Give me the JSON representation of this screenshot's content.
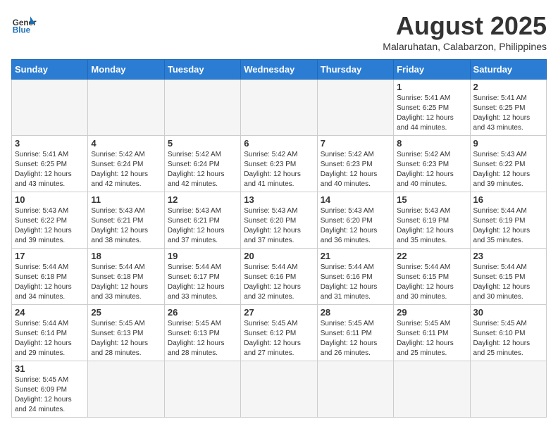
{
  "logo": {
    "text_general": "General",
    "text_blue": "Blue"
  },
  "title": "August 2025",
  "subtitle": "Malaruhatan, Calabarzon, Philippines",
  "weekdays": [
    "Sunday",
    "Monday",
    "Tuesday",
    "Wednesday",
    "Thursday",
    "Friday",
    "Saturday"
  ],
  "weeks": [
    [
      {
        "day": "",
        "info": ""
      },
      {
        "day": "",
        "info": ""
      },
      {
        "day": "",
        "info": ""
      },
      {
        "day": "",
        "info": ""
      },
      {
        "day": "",
        "info": ""
      },
      {
        "day": "1",
        "info": "Sunrise: 5:41 AM\nSunset: 6:25 PM\nDaylight: 12 hours\nand 44 minutes."
      },
      {
        "day": "2",
        "info": "Sunrise: 5:41 AM\nSunset: 6:25 PM\nDaylight: 12 hours\nand 43 minutes."
      }
    ],
    [
      {
        "day": "3",
        "info": "Sunrise: 5:41 AM\nSunset: 6:25 PM\nDaylight: 12 hours\nand 43 minutes."
      },
      {
        "day": "4",
        "info": "Sunrise: 5:42 AM\nSunset: 6:24 PM\nDaylight: 12 hours\nand 42 minutes."
      },
      {
        "day": "5",
        "info": "Sunrise: 5:42 AM\nSunset: 6:24 PM\nDaylight: 12 hours\nand 42 minutes."
      },
      {
        "day": "6",
        "info": "Sunrise: 5:42 AM\nSunset: 6:23 PM\nDaylight: 12 hours\nand 41 minutes."
      },
      {
        "day": "7",
        "info": "Sunrise: 5:42 AM\nSunset: 6:23 PM\nDaylight: 12 hours\nand 40 minutes."
      },
      {
        "day": "8",
        "info": "Sunrise: 5:42 AM\nSunset: 6:23 PM\nDaylight: 12 hours\nand 40 minutes."
      },
      {
        "day": "9",
        "info": "Sunrise: 5:43 AM\nSunset: 6:22 PM\nDaylight: 12 hours\nand 39 minutes."
      }
    ],
    [
      {
        "day": "10",
        "info": "Sunrise: 5:43 AM\nSunset: 6:22 PM\nDaylight: 12 hours\nand 39 minutes."
      },
      {
        "day": "11",
        "info": "Sunrise: 5:43 AM\nSunset: 6:21 PM\nDaylight: 12 hours\nand 38 minutes."
      },
      {
        "day": "12",
        "info": "Sunrise: 5:43 AM\nSunset: 6:21 PM\nDaylight: 12 hours\nand 37 minutes."
      },
      {
        "day": "13",
        "info": "Sunrise: 5:43 AM\nSunset: 6:20 PM\nDaylight: 12 hours\nand 37 minutes."
      },
      {
        "day": "14",
        "info": "Sunrise: 5:43 AM\nSunset: 6:20 PM\nDaylight: 12 hours\nand 36 minutes."
      },
      {
        "day": "15",
        "info": "Sunrise: 5:43 AM\nSunset: 6:19 PM\nDaylight: 12 hours\nand 35 minutes."
      },
      {
        "day": "16",
        "info": "Sunrise: 5:44 AM\nSunset: 6:19 PM\nDaylight: 12 hours\nand 35 minutes."
      }
    ],
    [
      {
        "day": "17",
        "info": "Sunrise: 5:44 AM\nSunset: 6:18 PM\nDaylight: 12 hours\nand 34 minutes."
      },
      {
        "day": "18",
        "info": "Sunrise: 5:44 AM\nSunset: 6:18 PM\nDaylight: 12 hours\nand 33 minutes."
      },
      {
        "day": "19",
        "info": "Sunrise: 5:44 AM\nSunset: 6:17 PM\nDaylight: 12 hours\nand 33 minutes."
      },
      {
        "day": "20",
        "info": "Sunrise: 5:44 AM\nSunset: 6:16 PM\nDaylight: 12 hours\nand 32 minutes."
      },
      {
        "day": "21",
        "info": "Sunrise: 5:44 AM\nSunset: 6:16 PM\nDaylight: 12 hours\nand 31 minutes."
      },
      {
        "day": "22",
        "info": "Sunrise: 5:44 AM\nSunset: 6:15 PM\nDaylight: 12 hours\nand 30 minutes."
      },
      {
        "day": "23",
        "info": "Sunrise: 5:44 AM\nSunset: 6:15 PM\nDaylight: 12 hours\nand 30 minutes."
      }
    ],
    [
      {
        "day": "24",
        "info": "Sunrise: 5:44 AM\nSunset: 6:14 PM\nDaylight: 12 hours\nand 29 minutes."
      },
      {
        "day": "25",
        "info": "Sunrise: 5:45 AM\nSunset: 6:13 PM\nDaylight: 12 hours\nand 28 minutes."
      },
      {
        "day": "26",
        "info": "Sunrise: 5:45 AM\nSunset: 6:13 PM\nDaylight: 12 hours\nand 28 minutes."
      },
      {
        "day": "27",
        "info": "Sunrise: 5:45 AM\nSunset: 6:12 PM\nDaylight: 12 hours\nand 27 minutes."
      },
      {
        "day": "28",
        "info": "Sunrise: 5:45 AM\nSunset: 6:11 PM\nDaylight: 12 hours\nand 26 minutes."
      },
      {
        "day": "29",
        "info": "Sunrise: 5:45 AM\nSunset: 6:11 PM\nDaylight: 12 hours\nand 25 minutes."
      },
      {
        "day": "30",
        "info": "Sunrise: 5:45 AM\nSunset: 6:10 PM\nDaylight: 12 hours\nand 25 minutes."
      }
    ],
    [
      {
        "day": "31",
        "info": "Sunrise: 5:45 AM\nSunset: 6:09 PM\nDaylight: 12 hours\nand 24 minutes."
      },
      {
        "day": "",
        "info": ""
      },
      {
        "day": "",
        "info": ""
      },
      {
        "day": "",
        "info": ""
      },
      {
        "day": "",
        "info": ""
      },
      {
        "day": "",
        "info": ""
      },
      {
        "day": "",
        "info": ""
      }
    ]
  ]
}
